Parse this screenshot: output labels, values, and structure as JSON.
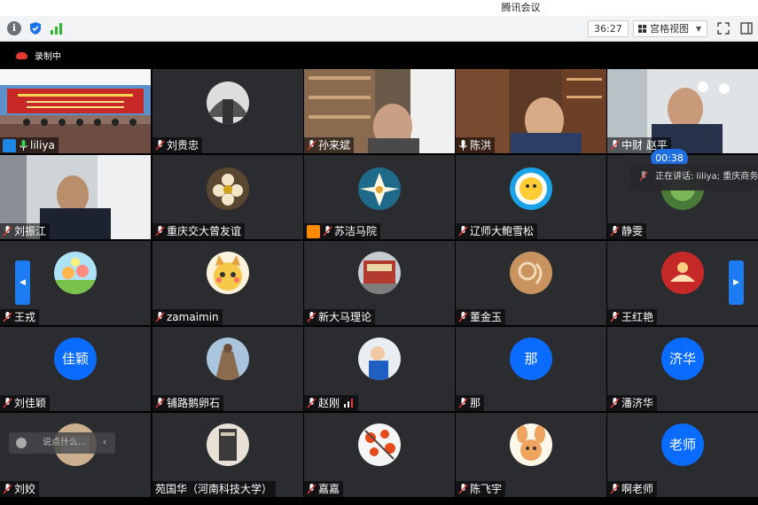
{
  "window": {
    "title": "腾讯会议"
  },
  "toolbar": {
    "timer": "36:27",
    "view_label": "宫格视图",
    "view_chevron": "▼"
  },
  "meeting": {
    "recording_label": "录制中",
    "talk_timer": "00:38",
    "talk_tip": "正在讲话: liliya; 重庆商务",
    "chat_placeholder": "说点什么...",
    "chat_arrow": "‹",
    "nav_left": "◀",
    "nav_right": "▶"
  },
  "participants": [
    {
      "name": "liliya"
    },
    {
      "name": "刘贵忠"
    },
    {
      "name": "孙来斌"
    },
    {
      "name": "陈洪"
    },
    {
      "name": "中财 赵平"
    },
    {
      "name": "刘振江"
    },
    {
      "name": "重庆交大曾友谊"
    },
    {
      "name": "苏洁马院"
    },
    {
      "name": "辽师大鲍雪松"
    },
    {
      "name": "静雯"
    },
    {
      "name": "王戎"
    },
    {
      "name": "zamaimin"
    },
    {
      "name": "新大马理论"
    },
    {
      "name": "董金玉"
    },
    {
      "name": "王红艳"
    },
    {
      "name": "刘佳颖",
      "avatar_text": "佳颖"
    },
    {
      "name": "铺路鹅卵石"
    },
    {
      "name": "赵刚"
    },
    {
      "name": "那",
      "avatar_text": "那"
    },
    {
      "name": "潘济华",
      "avatar_text": "济华"
    },
    {
      "name": "刘姣"
    },
    {
      "name": "苑国华（河南科技大学）"
    },
    {
      "name": "嘉嘉"
    },
    {
      "name": "陈飞宇"
    },
    {
      "name": "啊老师",
      "avatar_text": "老师"
    }
  ]
}
